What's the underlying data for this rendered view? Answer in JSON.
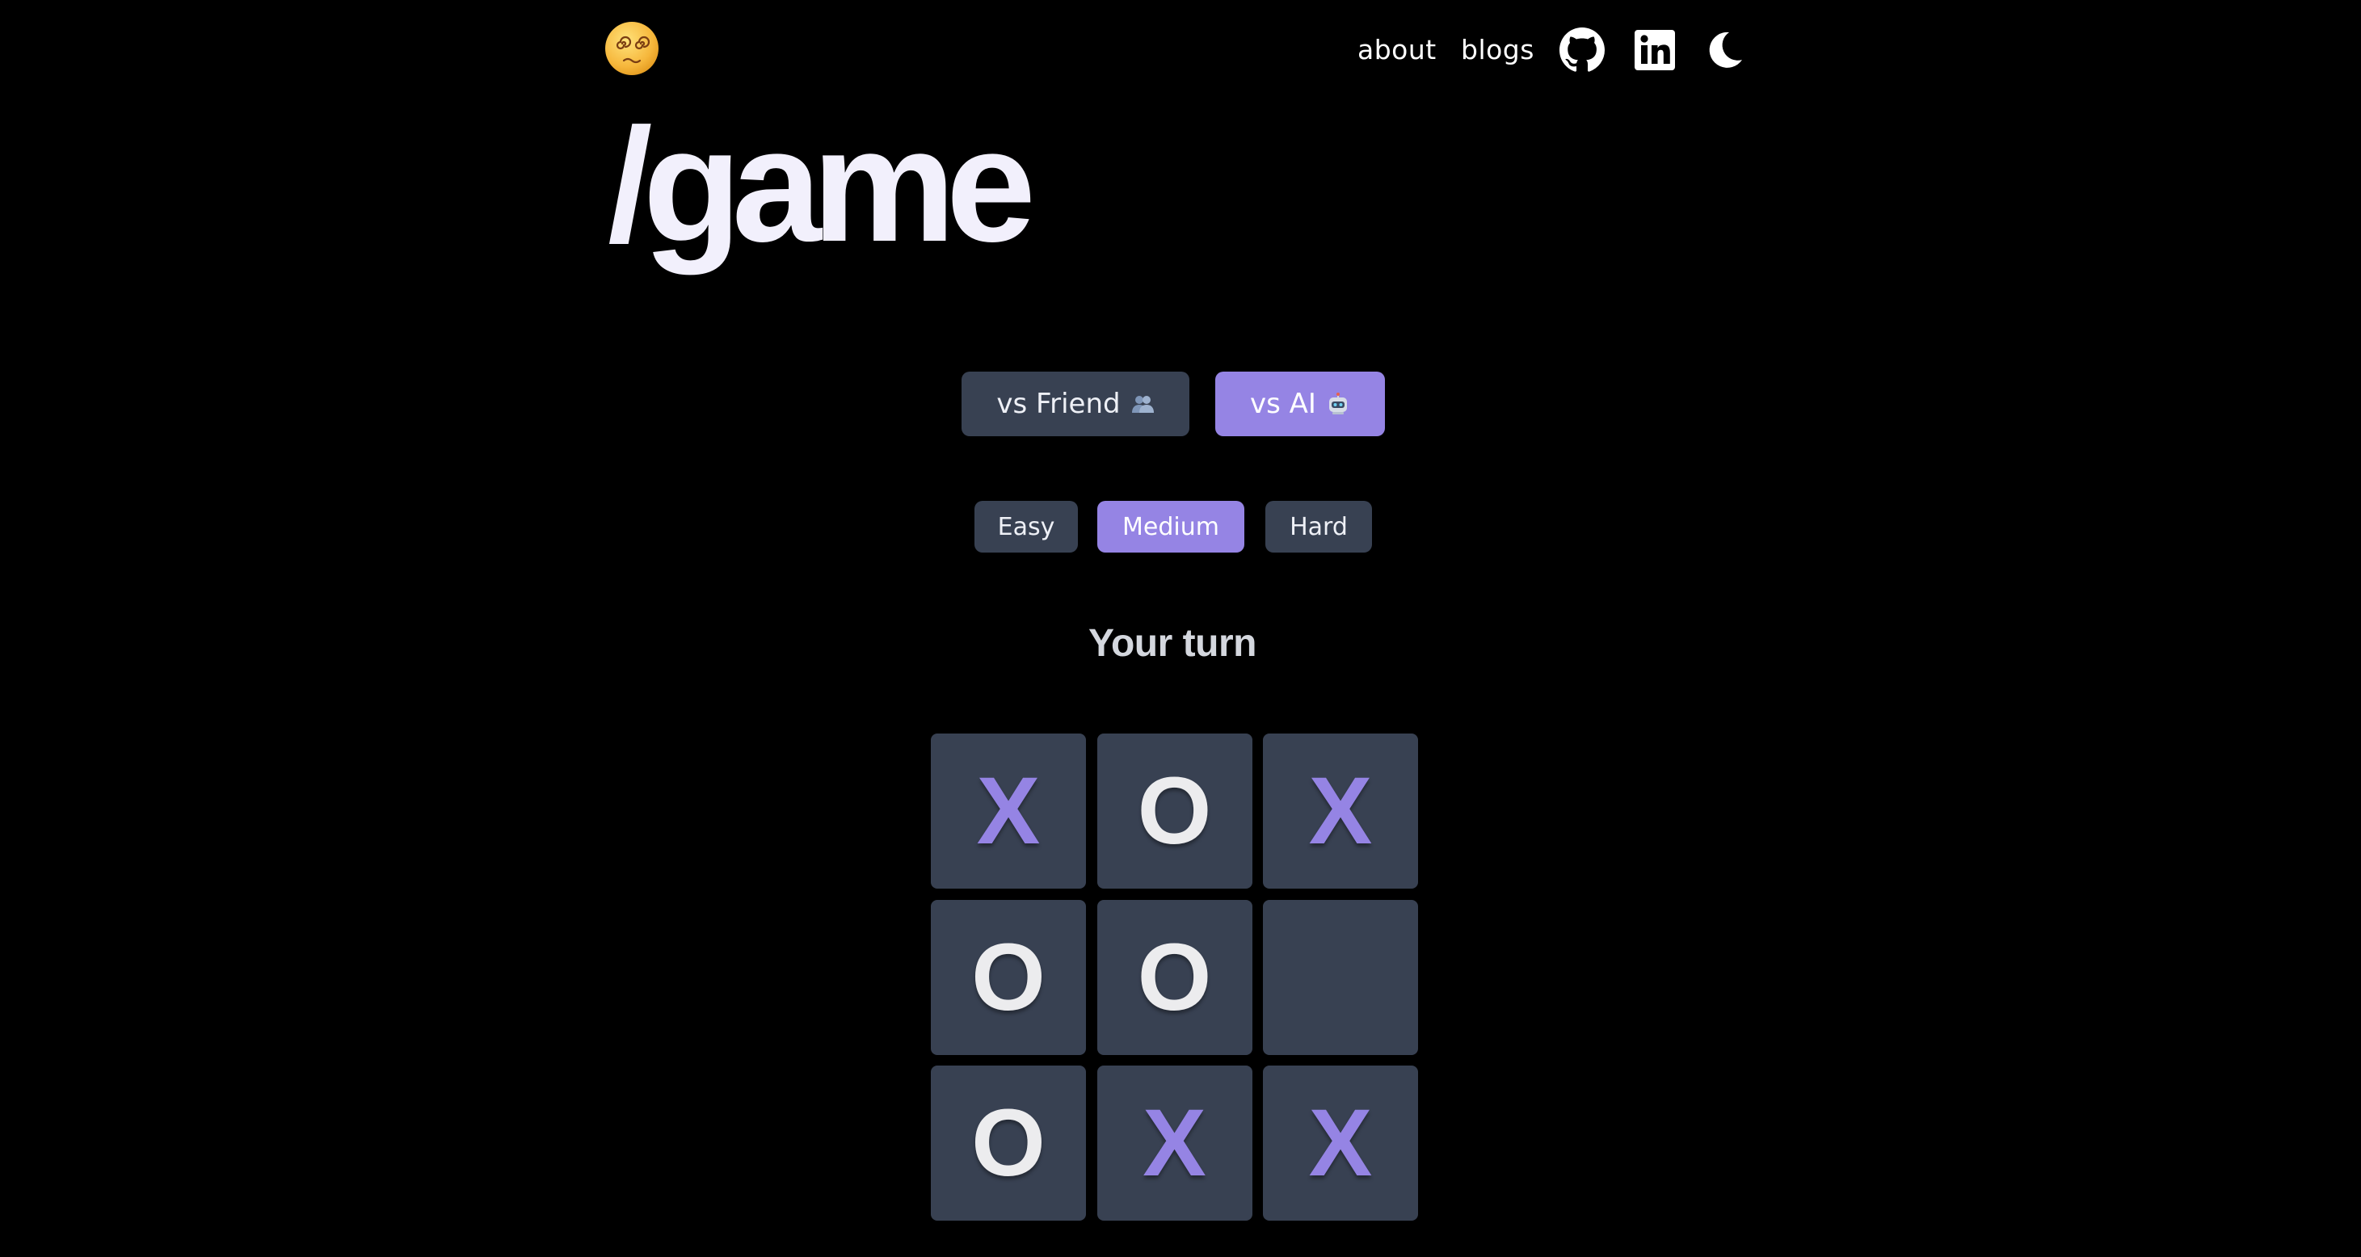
{
  "header": {
    "logo_icon": "dizzy-spiral-eyes-face-icon",
    "nav": [
      {
        "label": "about"
      },
      {
        "label": "blogs"
      }
    ],
    "icons": [
      "github-icon",
      "linkedin-icon",
      "moon-icon"
    ]
  },
  "page_title": "/game",
  "modes": {
    "friend_label": "vs Friend",
    "friend_icon": "two-people-icon",
    "ai_label": "vs AI",
    "ai_icon": "robot-icon",
    "selected": "vs AI"
  },
  "difficulty": {
    "options": [
      "Easy",
      "Medium",
      "Hard"
    ],
    "selected": "Medium"
  },
  "status": "Your turn",
  "board": [
    [
      "X",
      "O",
      "X"
    ],
    [
      "O",
      "O",
      ""
    ],
    [
      "O",
      "X",
      "X"
    ]
  ],
  "colors": {
    "background": "#000000",
    "accent": "#9584e4",
    "button_muted": "#384152",
    "cell": "#384152",
    "x_mark": "#9584e4",
    "o_mark": "#ececee",
    "status_text": "#d4d7de"
  }
}
